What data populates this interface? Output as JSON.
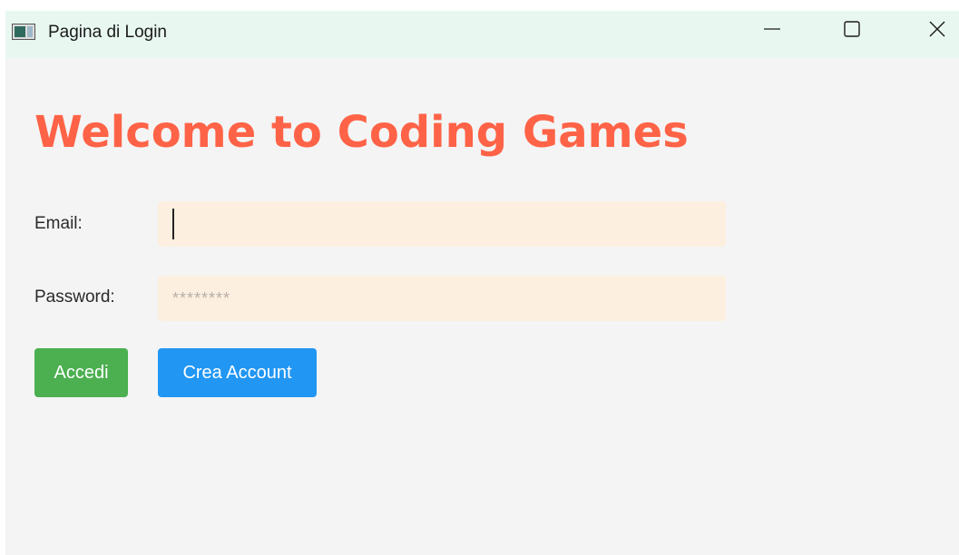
{
  "window": {
    "title": "Pagina di Login",
    "title_bar_color": "#e8f8f1"
  },
  "main": {
    "heading": "Welcome to Coding Games",
    "heading_color": "#ff6347",
    "email_label": "Email:",
    "email_value": "",
    "password_label": "Password:",
    "password_placeholder": "********",
    "login_button": "Accedi",
    "login_button_color": "#4caf50",
    "create_account_button": "Crea Account",
    "create_account_button_color": "#2196f3",
    "input_background": "#fdefe0"
  },
  "icons": {
    "app": "app-window-icon",
    "minimize": "minimize-icon",
    "maximize": "maximize-icon",
    "close": "close-icon"
  }
}
